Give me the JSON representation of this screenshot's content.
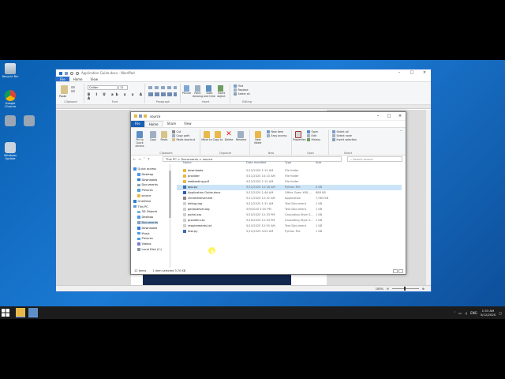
{
  "desktop": {
    "icons": [
      {
        "label": "Recycle Bin",
        "name": "recycle-bin-icon"
      },
      {
        "label": "Google Chrome",
        "name": "chrome-icon"
      },
      {
        "label": "",
        "name": "network-drive-icon-1"
      },
      {
        "label": "",
        "name": "network-drive-icon-2"
      },
      {
        "label": "Windows Update",
        "name": "windows-update-icon"
      }
    ]
  },
  "wordpad": {
    "title": "Application Guide.docx - WordPad",
    "tabs": [
      "File",
      "Home",
      "View"
    ],
    "font_name": "Calibri",
    "font_size": "11",
    "groups": [
      "Clipboard",
      "Font",
      "Paragraph",
      "Insert",
      "Editing"
    ],
    "paste": "Paste",
    "insert_buttons": [
      "Picture",
      "Paint drawing",
      "Date and time",
      "Insert object"
    ],
    "editing": [
      "Find",
      "Replace",
      "Select all"
    ],
    "zoom": "100%"
  },
  "explorer": {
    "title": "source",
    "tabs": [
      "File",
      "Home",
      "Share",
      "View"
    ],
    "ribbon": {
      "clipboard": {
        "pin": "Pin to Quick access",
        "copy": "Copy",
        "paste": "Paste",
        "cut": "Cut",
        "copy_path": "Copy path",
        "paste_shortcut": "Paste shortcut",
        "label": "Clipboard"
      },
      "organize": {
        "move": "Move to",
        "copy": "Copy to",
        "delete": "Delete",
        "rename": "Rename",
        "label": "Organize"
      },
      "new": {
        "folder": "New folder",
        "item": "New item",
        "easy": "Easy access",
        "label": "New"
      },
      "open": {
        "properties": "Properties",
        "open": "Open",
        "edit": "Edit",
        "history": "History",
        "label": "Open"
      },
      "select": {
        "all": "Select all",
        "none": "Select none",
        "invert": "Invert selection",
        "label": "Select"
      }
    },
    "path": "This PC  >  Documents  >  source",
    "search_placeholder": "Search source",
    "nav": [
      {
        "label": "Quick access",
        "color": "#3b8ee6",
        "indent": 0
      },
      {
        "label": "Desktop",
        "color": "#4a9be8",
        "indent": 1
      },
      {
        "label": "Downloads",
        "color": "#2b7bd6",
        "indent": 1
      },
      {
        "label": "Documents",
        "color": "#8aa0b8",
        "indent": 1
      },
      {
        "label": "Pictures",
        "color": "#4aa0e0",
        "indent": 1
      },
      {
        "label": "source",
        "color": "#e8b94a",
        "indent": 1
      },
      {
        "label": "OneDrive",
        "color": "#2d7fd6",
        "indent": 0
      },
      {
        "label": "This PC",
        "color": "#5b9ad6",
        "indent": 0
      },
      {
        "label": "3D Objects",
        "color": "#6fb1e6",
        "indent": 1
      },
      {
        "label": "Desktop",
        "color": "#4a9be8",
        "indent": 1
      },
      {
        "label": "Documents",
        "color": "#8aa0b8",
        "indent": 1,
        "selected": true
      },
      {
        "label": "Downloads",
        "color": "#2b7bd6",
        "indent": 1
      },
      {
        "label": "Music",
        "color": "#4a9be8",
        "indent": 1
      },
      {
        "label": "Pictures",
        "color": "#4aa0e0",
        "indent": 1
      },
      {
        "label": "Videos",
        "color": "#7a7ad6",
        "indent": 1
      },
      {
        "label": "Local Disk (C:)",
        "color": "#8a9aa8",
        "indent": 1
      }
    ],
    "columns": [
      "Name",
      "Date modified",
      "Type",
      "Size"
    ],
    "files": [
      {
        "name": "downloads",
        "date": "5/12/2020 1:15 AM",
        "type": "File folder",
        "size": "",
        "color": "#e8b94a"
      },
      {
        "name": "provider",
        "date": "5/11/2020 10:10 AM",
        "type": "File folder",
        "size": "",
        "color": "#e8b94a"
      },
      {
        "name": "webtesting.pdf",
        "date": "5/12/2020 1:15 AM",
        "type": "File folder",
        "size": "",
        "color": "#e8b94a"
      },
      {
        "name": "app.py",
        "date": "5/12/2020 12:18 AM",
        "type": "Python File",
        "size": "4 KB",
        "color": "#3a6fb0",
        "selected": true
      },
      {
        "name": "Application Guide.docx",
        "date": "5/12/2020 1:46 AM",
        "type": "Office Open XML ...",
        "size": "888 KB",
        "color": "#2b5fb3"
      },
      {
        "name": "chromedriver.exe",
        "date": "5/11/2020 12:32 AM",
        "type": "Application",
        "size": "7,983 KB",
        "color": "#8a8a8a"
      },
      {
        "name": "debug.log",
        "date": "5/12/2020 1:31 AM",
        "type": "Text Document",
        "size": "1 KB",
        "color": "#cfcfcf"
      },
      {
        "name": "geckodriver.log",
        "date": "5/9/2020 5:50 PM",
        "type": "Text Document",
        "size": "1 KB",
        "color": "#cfcfcf"
      },
      {
        "name": "portal.css",
        "date": "5/10/2020 12:33 PM",
        "type": "Cascading Style S...",
        "size": "1 KB",
        "color": "#cfcfcf"
      },
      {
        "name": "provider.css",
        "date": "5/10/2020 12:33 PM",
        "type": "Cascading Style S...",
        "size": "1 KB",
        "color": "#cfcfcf"
      },
      {
        "name": "requirements.txt",
        "date": "5/10/2020 12:55 AM",
        "type": "Text Document",
        "size": "1 KB",
        "color": "#cfcfcf"
      },
      {
        "name": "test.py",
        "date": "5/12/2020 4:05 AM",
        "type": "Python File",
        "size": "1 KB",
        "color": "#3a6fb0"
      }
    ],
    "status_items": "12 items",
    "status_selected": "1 item selected  3.70 KB"
  },
  "taskbar": {
    "lang": "ENG",
    "time": "1:53 AM",
    "date": "5/12/2020"
  }
}
